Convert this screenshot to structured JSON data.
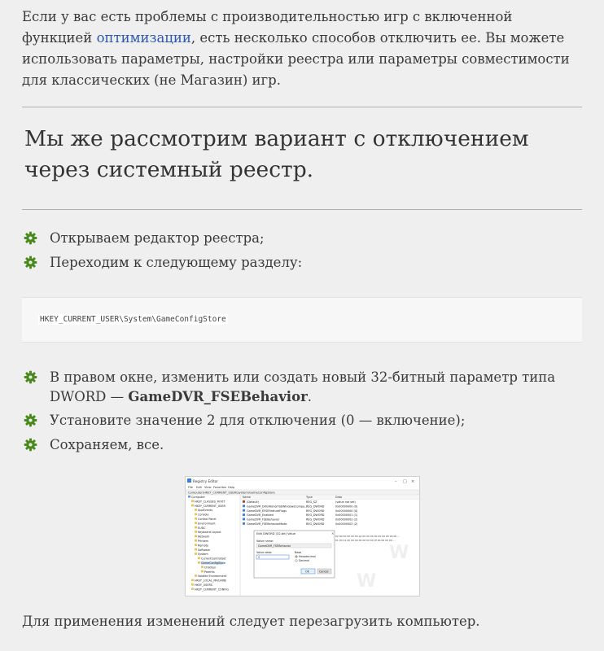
{
  "intro": {
    "text_before_link": "Если у вас есть проблемы с производительностью игр с включенной функцией ",
    "link_text": "оптимизации",
    "text_after_link": ", есть несколько способов отключить ее. Вы можете использовать параметры, настройки реестра или параметры совместимости для классических (не Магазин) игр."
  },
  "heading": "Мы же рассмотрим вариант с отключением через системный реестр.",
  "steps_first": [
    {
      "text": "Открываем редактор реестра;"
    },
    {
      "text": "Переходим к следующему разделу:"
    }
  ],
  "registry_path": "HKEY_CURRENT_USER\\System\\GameConfigStore",
  "steps_second": [
    {
      "text_before": "В правом окне, изменить или создать новый 32-битный параметр типа DWORD — ",
      "bold": "GameDVR_FSEBehavior",
      "text_after": "."
    },
    {
      "text": "Установите значение 2 для отключения (0 — включение);"
    },
    {
      "text": "Сохраняем, все."
    }
  ],
  "screenshot": {
    "window_title": "Registry Editor",
    "menu": [
      "File",
      "Edit",
      "View",
      "Favorites",
      "Help"
    ],
    "address": "Computer\\HKEY_CURRENT_USER\\System\\GameConfigStore",
    "tree": [
      "Computer",
      "HKEY_CLASSES_ROOT",
      "HKEY_CURRENT_USER",
      "AppEvents",
      "Console",
      "Control Panel",
      "Environment",
      "EUDC",
      "Keyboard Layout",
      "Network",
      "Printers",
      "Remote",
      "Software",
      "System",
      "CurrentControlSet",
      "GameConfigStore",
      "Children",
      "Parents",
      "Volatile Environment",
      "HKEY_LOCAL_MACHINE",
      "HKEY_USERS",
      "HKEY_CURRENT_CONFIG"
    ],
    "columns": [
      "Name",
      "Type",
      "Data"
    ],
    "rows": [
      {
        "name": "(Default)",
        "type": "REG_SZ",
        "data": "(value not set)"
      },
      {
        "name": "GameDVR_DXGIHonorFSEWindowsCompa...",
        "type": "REG_DWORD",
        "data": "0x00000000 (0)"
      },
      {
        "name": "GameDVR_EFSEFeatureFlags",
        "type": "REG_DWORD",
        "data": "0x00000000 (0)"
      },
      {
        "name": "GameDVR_Enabled",
        "type": "REG_DWORD",
        "data": "0x00000001 (1)"
      },
      {
        "name": "GameDVR_FSEBehavior",
        "type": "REG_DWORD",
        "data": "0x00000002 (2)"
      },
      {
        "name": "GameDVR_FSEBehaviorMode",
        "type": "REG_DWORD",
        "data": "0x00000002 (2)"
      }
    ],
    "dialog": {
      "title": "Edit DWORD (32-bit) Value",
      "value_name_label": "Value name:",
      "value_name": "GameDVR_FSEBehavior",
      "value_data_label": "Value data:",
      "value_data": "2",
      "base_label": "Base",
      "hex_label": "Hexadecimal",
      "dec_label": "Decimal",
      "ok_label": "OK",
      "cancel_label": "Cancel"
    }
  },
  "final_text": "Для применения изменений следует перезагрузить компьютер.",
  "colors": {
    "link": "#2a56b5",
    "bullet_icon": "#4a8a1c",
    "background": "#efefef"
  }
}
